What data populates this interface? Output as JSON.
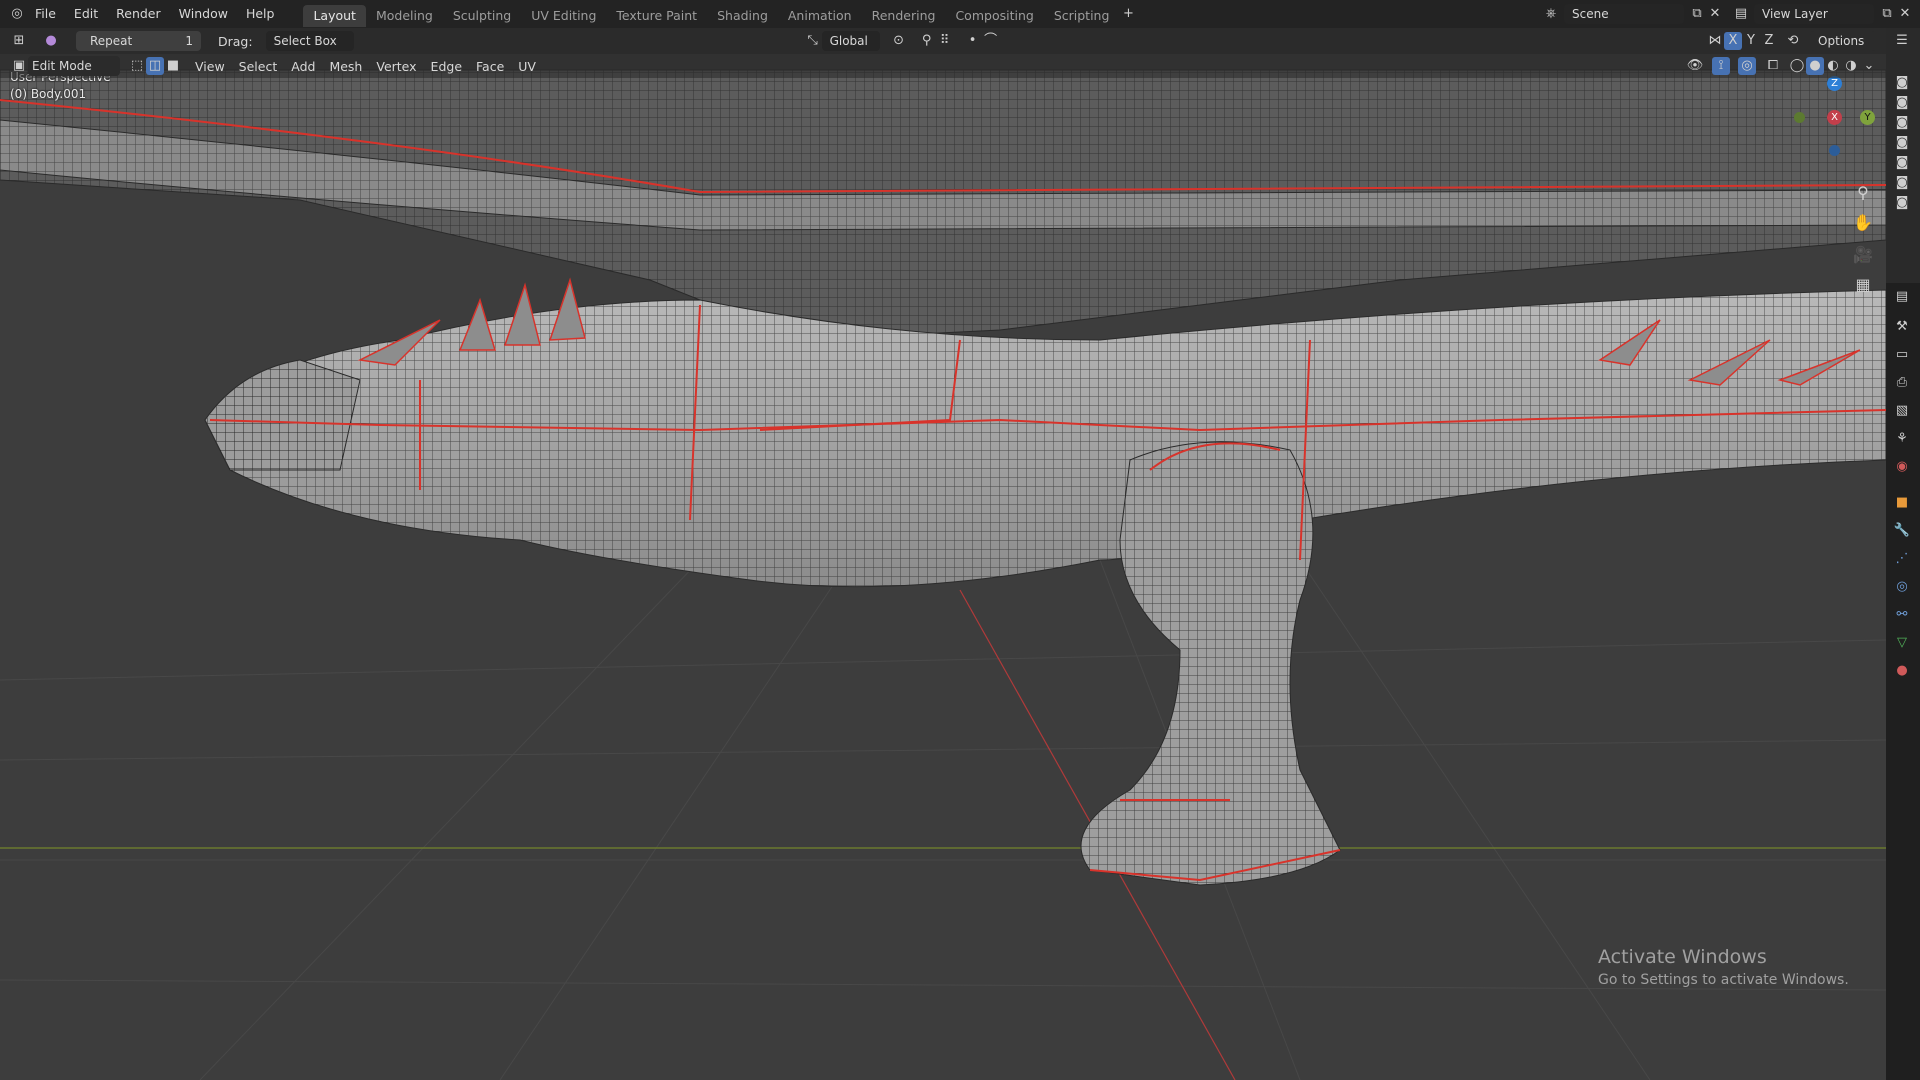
{
  "menus": [
    "File",
    "Edit",
    "Render",
    "Window",
    "Help"
  ],
  "workspaces": [
    "Layout",
    "Modeling",
    "Sculpting",
    "UV Editing",
    "Texture Paint",
    "Shading",
    "Animation",
    "Rendering",
    "Compositing",
    "Scripting"
  ],
  "active_workspace": "Layout",
  "scene": {
    "label": "Scene",
    "view_layer": "View Layer"
  },
  "tool_header": {
    "repeat_label": "Repeat",
    "repeat_count": "1",
    "drag_label": "Drag:",
    "drag_value": "Select Box",
    "transform_orientation": "Global",
    "axes": [
      "X",
      "Y",
      "Z"
    ],
    "options_label": "Options"
  },
  "viewport_header": {
    "mode": "Edit Mode",
    "menus": [
      "View",
      "Select",
      "Add",
      "Mesh",
      "Vertex",
      "Edge",
      "Face",
      "UV"
    ]
  },
  "viewport": {
    "perspective": "User Perspective",
    "object": "(0) Body.001"
  },
  "gizmo": {
    "z": "Z",
    "x": "X",
    "y": "Y"
  },
  "watermark": {
    "title": "Activate Windows",
    "subtitle": "Go to Settings to activate Windows."
  },
  "colors": {
    "seam": "#d8332b",
    "mesh": "#9a9a9a",
    "x_axis": "#c33f4b",
    "y_axis": "#7fa33c",
    "z_axis": "#2d7fd6"
  }
}
